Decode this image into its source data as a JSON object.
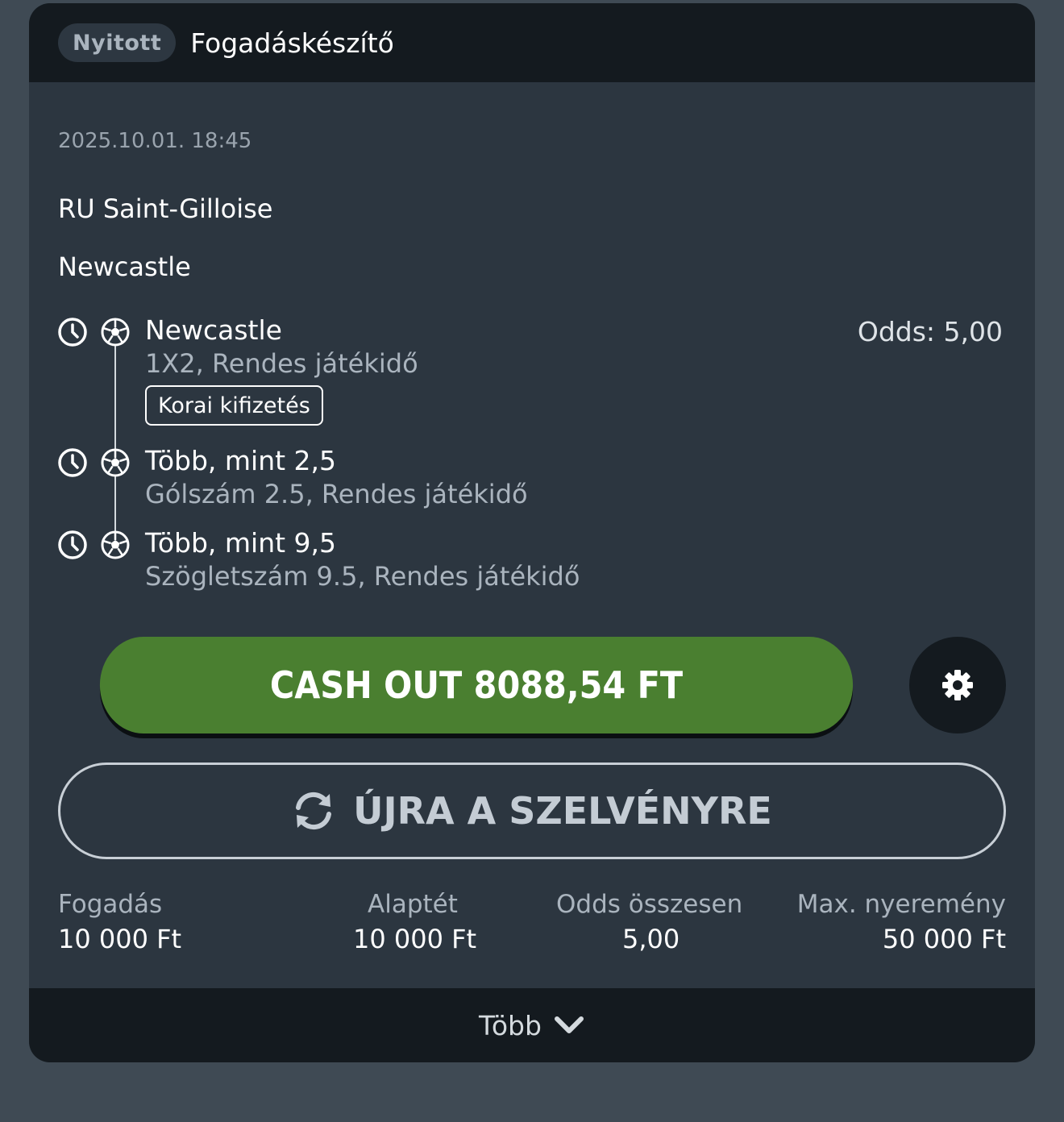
{
  "header": {
    "status_pill": "Nyitott",
    "title": "Fogadáskészítő"
  },
  "event": {
    "datetime": "2025.10.01.  18:45",
    "home_team": "RU Saint-Gilloise",
    "away_team": "Newcastle"
  },
  "selections": [
    {
      "name": "Newcastle",
      "market": "1X2, Rendes játékidő",
      "badge": "Korai kifizetés"
    },
    {
      "name": "Több, mint 2,5",
      "market": "Gólszám 2.5, Rendes játékidő"
    },
    {
      "name": "Több, mint 9,5",
      "market": "Szögletszám 9.5, Rendes játékidő"
    }
  ],
  "odds_label": "Odds:  5,00",
  "cashout_label": "CASH OUT 8088,54 FT",
  "rebet_label": "ÚJRA A SZELVÉNYRE",
  "stats": [
    {
      "label": "Fogadás",
      "value": "10 000 Ft"
    },
    {
      "label": "Alaptét",
      "value": "10 000 Ft"
    },
    {
      "label": "Odds összesen",
      "value": "5,00"
    },
    {
      "label": "Max. nyeremény",
      "value": "50 000 Ft"
    }
  ],
  "footer": {
    "more_label": "Több"
  },
  "icons": {
    "clock": "clock-icon",
    "ball": "soccer-ball-icon",
    "gear": "gear-icon",
    "refresh": "refresh-icon",
    "chevron": "chevron-down-icon"
  },
  "colors": {
    "cashout_green": "#4a7f30",
    "card_bg": "#2c3640",
    "header_bg": "#141a1f"
  }
}
